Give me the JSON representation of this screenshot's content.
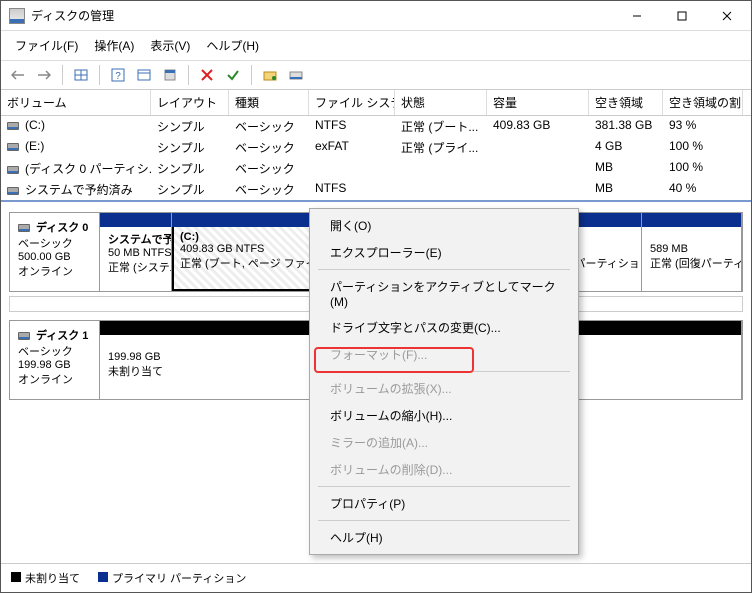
{
  "title": "ディスクの管理",
  "menu": {
    "file": "ファイル(F)",
    "action": "操作(A)",
    "view": "表示(V)",
    "help": "ヘルプ(H)"
  },
  "columns": {
    "volume": "ボリューム",
    "layout": "レイアウト",
    "type": "種類",
    "fs": "ファイル システム",
    "status": "状態",
    "capacity": "容量",
    "free": "空き領域",
    "pct": "空き領域の割..."
  },
  "rows": [
    {
      "vol": "(C:)",
      "lay": "シンプル",
      "typ": "ベーシック",
      "fs": "NTFS",
      "st": "正常 (ブート...",
      "cap": "409.83 GB",
      "free": "381.38 GB",
      "pct": "93 %"
    },
    {
      "vol": "(E:)",
      "lay": "シンプル",
      "typ": "ベーシック",
      "fs": "exFAT",
      "st": "正常 (プライ...",
      "cap": "",
      "free": "4 GB",
      "pct": "100 %"
    },
    {
      "vol": "(ディスク 0 パーティシ...",
      "lay": "シンプル",
      "typ": "ベーシック",
      "fs": "",
      "st": "",
      "cap": "",
      "free": "MB",
      "pct": "100 %"
    },
    {
      "vol": "システムで予約済み",
      "lay": "シンプル",
      "typ": "ベーシック",
      "fs": "NTFS",
      "st": "",
      "cap": "",
      "free": "MB",
      "pct": "40 %"
    }
  ],
  "disk0": {
    "label": "ディスク 0",
    "type": "ベーシック",
    "size": "500.00 GB",
    "state": "オンライン",
    "parts": [
      {
        "name": "システムで予",
        "line2": "50 MB NTFS",
        "line3": "正常 (システム"
      },
      {
        "name": "(C:)",
        "line2": "409.83 GB NTFS",
        "line3": "正常 (ブート, ページ ファイル, クラッシュ ダンプ, プ"
      },
      {
        "name": "",
        "line2": "",
        "line3": "正常 (プライマリ パーティション)"
      },
      {
        "name": "",
        "line2": "589 MB",
        "line3": "正常 (回復パーティション"
      }
    ]
  },
  "disk1": {
    "label": "ディスク 1",
    "type": "ベーシック",
    "size": "199.98 GB",
    "state": "オンライン",
    "parts": [
      {
        "name": "",
        "line2": "199.98 GB",
        "line3": "未割り当て"
      }
    ]
  },
  "legend": {
    "unalloc": "未割り当て",
    "primary": "プライマリ パーティション"
  },
  "ctx": {
    "open": "開く(O)",
    "explorer": "エクスプローラー(E)",
    "markactive": "パーティションをアクティブとしてマーク(M)",
    "changeletter": "ドライブ文字とパスの変更(C)...",
    "format": "フォーマット(F)...",
    "extend": "ボリュームの拡張(X)...",
    "shrink": "ボリュームの縮小(H)...",
    "mirror": "ミラーの追加(A)...",
    "delete": "ボリュームの削除(D)...",
    "prop": "プロパティ(P)",
    "help": "ヘルプ(H)"
  }
}
